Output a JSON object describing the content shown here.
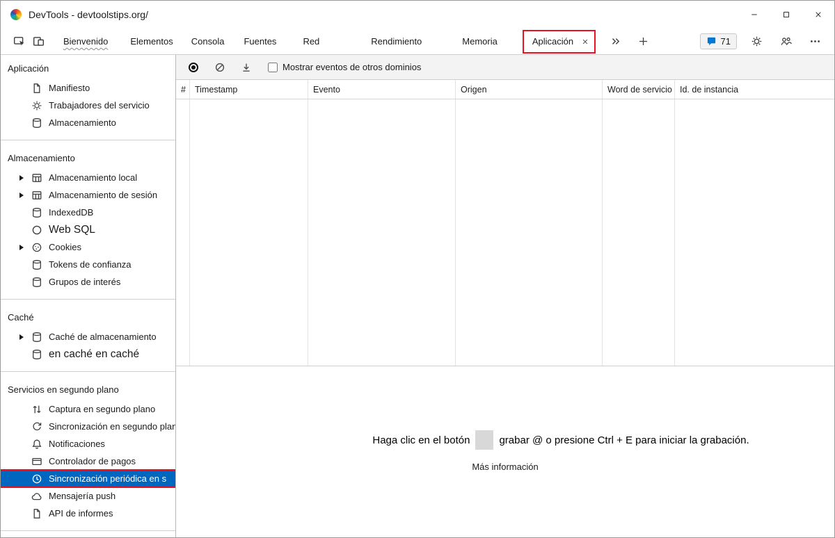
{
  "window": {
    "title": "DevTools - devtoolstips.org/",
    "controls": [
      "minimize-icon",
      "maximize-icon",
      "close-icon"
    ]
  },
  "tabbar": {
    "left_icons": [
      "inspect-icon",
      "device-toolbar-icon"
    ],
    "tabs": [
      {
        "label": "Bienvenido"
      },
      {
        "label": "Elementos"
      },
      {
        "label": "Consola"
      },
      {
        "label": "Fuentes"
      },
      {
        "label": "Red"
      },
      {
        "label": "Rendimiento"
      },
      {
        "label": "Memoria"
      },
      {
        "label": "Aplicación",
        "active": true,
        "closable": true,
        "annotated": true
      }
    ],
    "overflow_icon": "double-chevron-icon",
    "add_icon": "plus-icon",
    "badge_count": "71",
    "right_icons": [
      "feedback-bubble-icon",
      "settings-gear-icon",
      "people-icon",
      "more-menu-icon"
    ]
  },
  "sidebar": {
    "sections": [
      {
        "title": "Aplicación",
        "items": [
          {
            "label": "Manifiesto",
            "icon": "document-icon"
          },
          {
            "label": "Trabajadores del servicio",
            "icon": "gear-icon"
          },
          {
            "label": "Almacenamiento",
            "icon": "database-icon"
          }
        ]
      },
      {
        "title": "Almacenamiento",
        "items": [
          {
            "label": "Almacenamiento local",
            "icon": "table-icon",
            "expandable": true
          },
          {
            "label": "Almacenamiento de sesión",
            "icon": "table-icon",
            "expandable": true
          },
          {
            "label": "IndexedDB",
            "icon": "database-icon"
          },
          {
            "label": "Web SQL",
            "icon": "circle-icon"
          },
          {
            "label": "Cookies",
            "icon": "cookie-icon",
            "expandable": true
          },
          {
            "label": "Tokens de confianza",
            "icon": "database-icon"
          },
          {
            "label": "Grupos de interés",
            "icon": "database-icon"
          }
        ]
      },
      {
        "title": "Caché",
        "items": [
          {
            "label": "Caché de almacenamiento",
            "icon": "database-icon",
            "expandable": true
          },
          {
            "label": "en caché en caché",
            "icon": "database-icon"
          }
        ]
      },
      {
        "title": "Servicios en segundo plano",
        "items": [
          {
            "label": "Captura en segundo plano",
            "icon": "fetch-arrows-icon"
          },
          {
            "label": "Sincronización en segundo plano",
            "icon": "sync-icon"
          },
          {
            "label": "Notificaciones",
            "icon": "bell-icon"
          },
          {
            "label": "Controlador de pagos",
            "icon": "payment-card-icon"
          },
          {
            "label": "Sincronización periódica en s",
            "icon": "clock-icon",
            "selected": true,
            "annotated": true
          },
          {
            "label": "Mensajería push",
            "icon": "cloud-icon"
          },
          {
            "label": "API de informes",
            "icon": "document-icon"
          }
        ]
      }
    ]
  },
  "toolbar": {
    "icons": [
      "record-icon",
      "block-icon",
      "download-icon"
    ],
    "checkbox_label": "Mostrar eventos de otros dominios",
    "checkbox_checked": false
  },
  "table": {
    "columns": [
      "#",
      "Timestamp",
      "Evento",
      "Origen",
      "Word de servicio",
      "Id. de instancia"
    ],
    "rows": []
  },
  "empty_state": {
    "text_before": "Haga clic en el botón",
    "text_after": "grabar @ o presione Ctrl + E para iniciar la grabación.",
    "link": "Más información"
  },
  "colors": {
    "selection_blue": "#0067c0",
    "annotation_red": "#e81123",
    "toolbar_bg": "#f3f3f3",
    "badge_bubble_blue": "#0078d4"
  }
}
